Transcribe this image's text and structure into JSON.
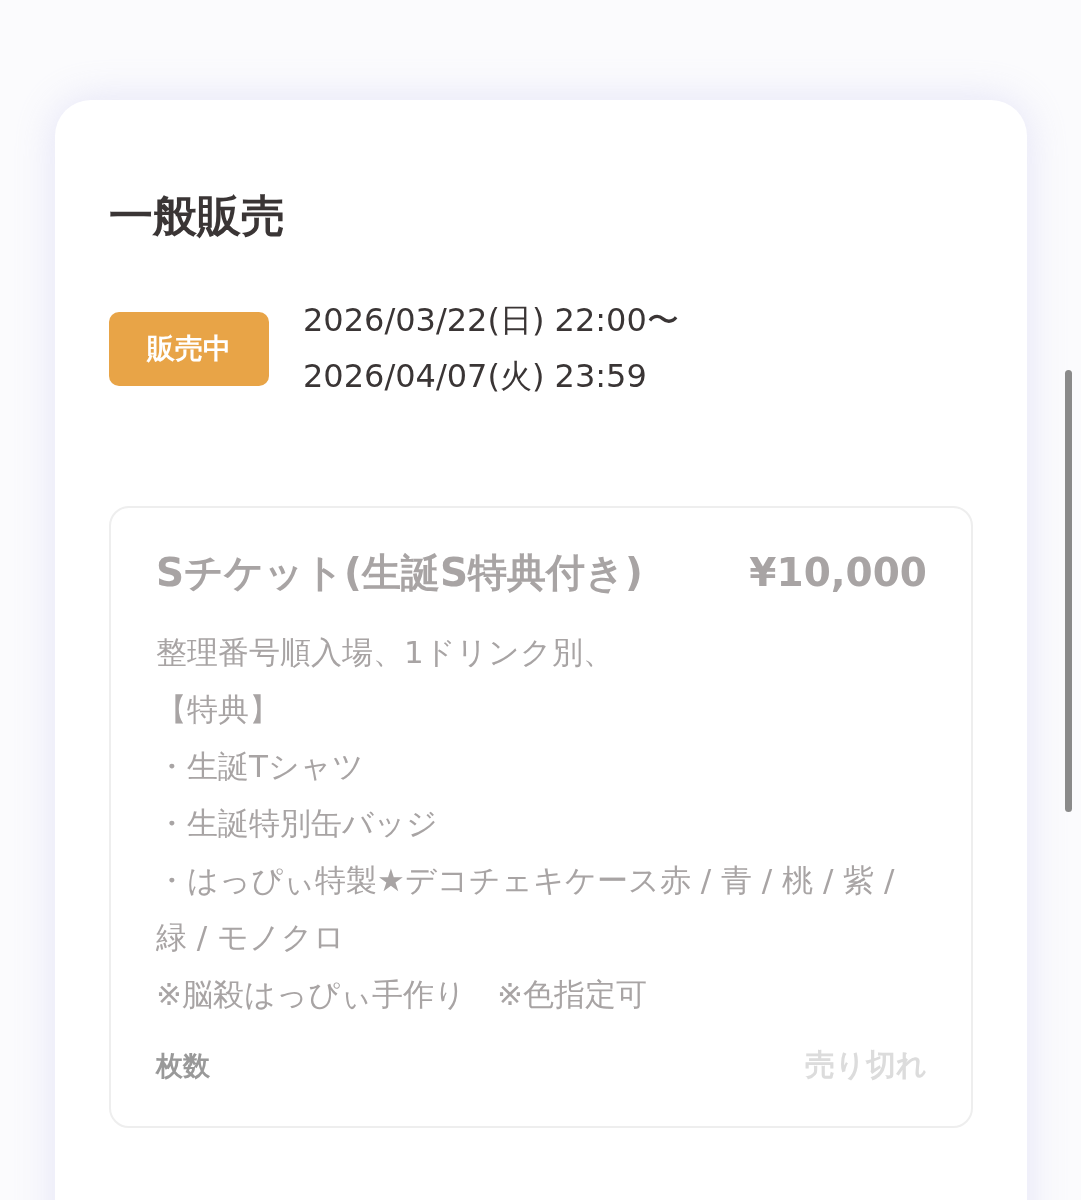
{
  "section": {
    "title": "一般販売",
    "status": {
      "kind": "on_sale",
      "label": "販売中"
    },
    "period": [
      "2026/03/22(日) 22:00〜",
      "2026/04/07(火) 23:59"
    ],
    "tickets": [
      {
        "name": "Sチケット(生誕S特典付き)",
        "price": "¥10,000",
        "sold_out": true,
        "description": [
          "整理番号順入場、1ドリンク別、",
          "【特典】",
          "・生誕Tシャツ",
          "・生誕特別缶バッジ",
          "・はっぴぃ特製★デコチェキケース赤 / 青 / 桃 / 紫 / 緑 / モノクロ",
          "※脳殺はっぴぃ手作り　※色指定可"
        ],
        "quantity_label": "枚数",
        "availability": "売り切れ"
      }
    ]
  }
}
